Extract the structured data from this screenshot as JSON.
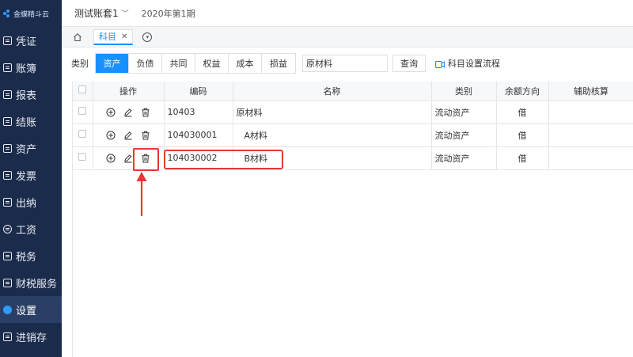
{
  "brand": {
    "logo_text": "金蝶精斗云"
  },
  "sidebar": {
    "items": [
      {
        "label": "凭证"
      },
      {
        "label": "账簿"
      },
      {
        "label": "报表"
      },
      {
        "label": "结账"
      },
      {
        "label": "资产"
      },
      {
        "label": "发票"
      },
      {
        "label": "出纳"
      },
      {
        "label": "工资"
      },
      {
        "label": "税务"
      },
      {
        "label": "财税服务"
      },
      {
        "label": "设置"
      },
      {
        "label": "进销存"
      }
    ],
    "active_index": 10
  },
  "topbar": {
    "account": "测试账套1",
    "period": "2020年第1期"
  },
  "tabs": {
    "active_label": "科目"
  },
  "filter": {
    "label": "类别",
    "categories": [
      "资产",
      "负债",
      "共同",
      "权益",
      "成本",
      "损益"
    ],
    "search_value": "原材料",
    "query_label": "查询",
    "flow_label": "科目设置流程"
  },
  "table": {
    "headers": [
      "操作",
      "编码",
      "名称",
      "类别",
      "余额方向",
      "辅助核算"
    ],
    "rows": [
      {
        "code": "10403",
        "name": "原材料",
        "category": "流动资产",
        "direction": "借",
        "aux": ""
      },
      {
        "code": "104030001",
        "name": "A材料",
        "category": "流动资产",
        "direction": "借",
        "aux": ""
      },
      {
        "code": "104030002",
        "name": "B材料",
        "category": "流动资产",
        "direction": "借",
        "aux": ""
      }
    ]
  },
  "colors": {
    "sidebar_bg": "#1b2b4b",
    "accent": "#1890ff",
    "highlight": "#e53935"
  }
}
